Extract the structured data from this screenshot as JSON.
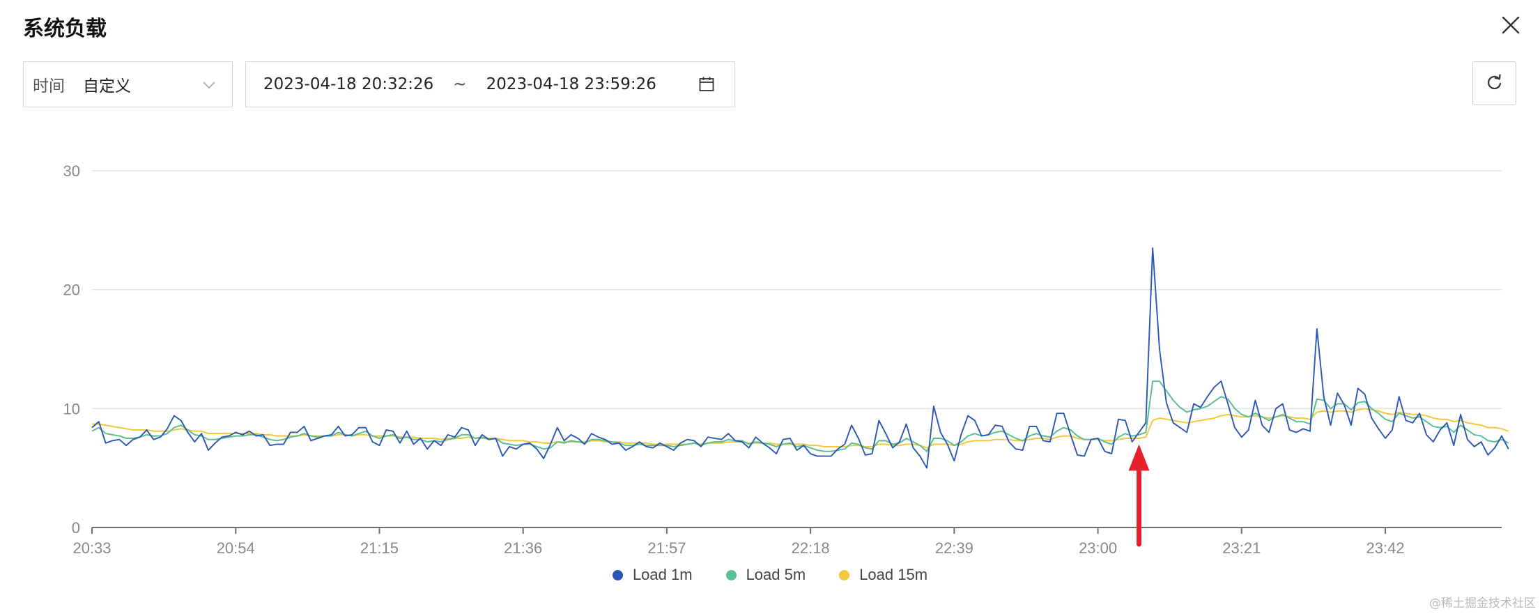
{
  "header": {
    "title": "系统负载"
  },
  "controls": {
    "time_label": "时间",
    "time_value": "自定义",
    "range_start": "2023-04-18 20:32:26",
    "range_separator": "~",
    "range_end": "2023-04-18 23:59:26"
  },
  "watermark": "@稀土掘金技术社区",
  "colors": {
    "load1": "#2a56b5",
    "load5": "#5cbf94",
    "load15": "#f2c83e",
    "grid": "#e2e2e2",
    "axis_text": "#888888",
    "arrow": "#e8202c"
  },
  "chart_data": {
    "type": "line",
    "title": "",
    "xlabel": "",
    "ylabel": "",
    "ylim": [
      0,
      30
    ],
    "yticks": [
      0,
      10,
      20,
      30
    ],
    "xticks": [
      "20:33",
      "20:54",
      "21:15",
      "21:36",
      "21:57",
      "22:18",
      "22:39",
      "23:00",
      "23:21",
      "23:42"
    ],
    "x_range": [
      "20:33",
      "23:59"
    ],
    "x_interval_minutes": 1,
    "grid": true,
    "legend_position": "bottom",
    "annotation": {
      "type": "arrow",
      "points_to": "23:06",
      "value": 7
    },
    "series": [
      {
        "name": "Load 1m",
        "values": [
          8.4,
          8.9,
          7.1,
          7.3,
          7.4,
          6.9,
          7.4,
          7.6,
          8.2,
          7.4,
          7.6,
          8.3,
          9.4,
          9.0,
          8.0,
          7.2,
          7.9,
          6.5,
          7.1,
          7.6,
          7.7,
          8.0,
          7.8,
          8.1,
          7.7,
          7.8,
          6.9,
          7.0,
          7.0,
          8.0,
          8.0,
          8.5,
          7.3,
          7.5,
          7.7,
          7.8,
          8.5,
          7.7,
          7.8,
          8.4,
          8.4,
          7.2,
          6.9,
          8.2,
          8.1,
          7.1,
          8.1,
          7.0,
          7.5,
          6.6,
          7.3,
          6.9,
          7.8,
          7.6,
          8.4,
          8.2,
          6.9,
          7.8,
          7.4,
          7.5,
          6.0,
          6.8,
          6.6,
          7.0,
          7.1,
          6.6,
          5.8,
          7.0,
          8.4,
          7.3,
          7.8,
          7.5,
          7.0,
          7.9,
          7.6,
          7.4,
          7.0,
          7.1,
          6.5,
          6.8,
          7.2,
          6.8,
          6.7,
          7.1,
          6.8,
          6.5,
          7.1,
          7.4,
          7.3,
          6.8,
          7.6,
          7.5,
          7.4,
          7.9,
          7.3,
          7.2,
          6.7,
          7.6,
          7.1,
          6.7,
          6.2,
          7.4,
          7.5,
          6.5,
          6.9,
          6.2,
          6.0,
          6.0,
          6.0,
          6.6,
          7.0,
          8.6,
          7.5,
          6.1,
          6.2,
          9.0,
          7.9,
          6.7,
          7.2,
          8.7,
          6.7,
          6.0,
          5.0,
          10.2,
          8.0,
          7.0,
          5.6,
          7.8,
          9.4,
          9.0,
          7.7,
          7.8,
          8.6,
          8.5,
          7.2,
          6.6,
          6.5,
          8.5,
          8.5,
          7.3,
          7.2,
          9.6,
          9.6,
          7.8,
          6.1,
          6.0,
          7.4,
          7.5,
          6.4,
          6.2,
          9.1,
          9.0,
          7.2,
          8.0,
          8.8,
          23.5,
          15.0,
          10.5,
          8.8,
          8.4,
          8.0,
          10.4,
          10.1,
          11.0,
          11.8,
          12.3,
          10.4,
          8.4,
          7.6,
          8.2,
          10.7,
          8.6,
          8.0,
          10.0,
          10.4,
          8.2,
          8.0,
          8.3,
          8.1,
          16.7,
          11.0,
          8.6,
          11.3,
          10.3,
          8.6,
          11.7,
          11.2,
          9.2,
          8.3,
          7.5,
          8.2,
          11.0,
          9.0,
          8.8,
          9.6,
          7.8,
          7.2,
          8.2,
          8.8,
          6.9,
          9.5,
          7.4,
          6.8,
          7.2,
          6.1,
          6.7,
          7.7,
          6.6
        ]
      },
      {
        "name": "Load 5m",
        "values": [
          8.1,
          8.4,
          7.9,
          7.8,
          7.7,
          7.5,
          7.5,
          7.6,
          7.8,
          7.7,
          7.7,
          7.9,
          8.4,
          8.6,
          8.2,
          7.8,
          7.7,
          7.4,
          7.4,
          7.5,
          7.6,
          7.7,
          7.7,
          7.8,
          7.8,
          7.6,
          7.4,
          7.3,
          7.4,
          7.6,
          7.7,
          7.9,
          7.7,
          7.6,
          7.7,
          7.7,
          8.0,
          7.8,
          7.7,
          7.9,
          8.1,
          7.7,
          7.5,
          7.7,
          7.8,
          7.5,
          7.6,
          7.4,
          7.4,
          7.2,
          7.3,
          7.2,
          7.4,
          7.5,
          7.8,
          7.8,
          7.5,
          7.6,
          7.4,
          7.5,
          7.1,
          7.0,
          6.9,
          7.0,
          7.0,
          6.8,
          6.6,
          6.7,
          7.2,
          7.1,
          7.3,
          7.2,
          7.1,
          7.4,
          7.4,
          7.3,
          7.2,
          7.1,
          6.9,
          6.9,
          7.0,
          6.9,
          6.9,
          6.9,
          6.9,
          6.8,
          6.9,
          7.0,
          7.1,
          6.9,
          7.1,
          7.2,
          7.2,
          7.4,
          7.3,
          7.3,
          7.0,
          7.2,
          7.1,
          7.0,
          6.8,
          7.0,
          7.1,
          6.8,
          6.9,
          6.7,
          6.5,
          6.4,
          6.4,
          6.5,
          6.6,
          7.1,
          7.0,
          6.7,
          6.6,
          7.3,
          7.3,
          7.0,
          7.1,
          7.5,
          7.2,
          6.9,
          6.4,
          7.5,
          7.5,
          7.3,
          6.9,
          7.2,
          7.7,
          7.9,
          7.7,
          7.8,
          8.0,
          8.1,
          7.8,
          7.5,
          7.3,
          7.7,
          7.9,
          7.7,
          7.6,
          8.1,
          8.4,
          8.2,
          7.7,
          7.4,
          7.4,
          7.5,
          7.2,
          7.0,
          7.6,
          7.9,
          7.7,
          7.8,
          8.0,
          12.3,
          12.3,
          11.5,
          10.7,
          10.1,
          9.7,
          9.9,
          10.0,
          10.2,
          10.6,
          11.0,
          10.8,
          10.0,
          9.5,
          9.3,
          9.6,
          9.3,
          9.0,
          9.3,
          9.5,
          9.2,
          8.9,
          8.9,
          8.7,
          10.8,
          10.7,
          10.0,
          10.4,
          10.4,
          9.9,
          10.5,
          10.6,
          10.0,
          9.6,
          9.1,
          8.9,
          9.6,
          9.4,
          9.2,
          9.3,
          8.9,
          8.5,
          8.4,
          8.5,
          8.0,
          8.6,
          8.2,
          7.8,
          7.7,
          7.3,
          7.2,
          7.4,
          7.1
        ]
      },
      {
        "name": "Load 15m",
        "values": [
          8.7,
          8.7,
          8.6,
          8.5,
          8.4,
          8.3,
          8.2,
          8.2,
          8.2,
          8.1,
          8.1,
          8.1,
          8.2,
          8.3,
          8.2,
          8.1,
          8.1,
          7.9,
          7.9,
          7.9,
          7.9,
          7.9,
          7.9,
          7.9,
          7.9,
          7.8,
          7.8,
          7.7,
          7.7,
          7.7,
          7.7,
          7.8,
          7.7,
          7.7,
          7.7,
          7.7,
          7.8,
          7.8,
          7.7,
          7.8,
          7.8,
          7.7,
          7.7,
          7.7,
          7.7,
          7.6,
          7.6,
          7.6,
          7.5,
          7.5,
          7.5,
          7.4,
          7.5,
          7.5,
          7.5,
          7.6,
          7.5,
          7.5,
          7.5,
          7.5,
          7.4,
          7.3,
          7.3,
          7.3,
          7.2,
          7.2,
          7.1,
          7.1,
          7.2,
          7.2,
          7.2,
          7.2,
          7.2,
          7.3,
          7.3,
          7.2,
          7.2,
          7.2,
          7.1,
          7.1,
          7.1,
          7.1,
          7.0,
          7.0,
          7.0,
          7.0,
          7.0,
          7.0,
          7.1,
          7.0,
          7.1,
          7.1,
          7.1,
          7.2,
          7.2,
          7.2,
          7.1,
          7.1,
          7.1,
          7.1,
          7.0,
          7.0,
          7.0,
          7.0,
          7.0,
          6.9,
          6.9,
          6.8,
          6.8,
          6.8,
          6.8,
          6.9,
          6.9,
          6.8,
          6.8,
          7.0,
          7.0,
          6.9,
          6.9,
          7.0,
          7.0,
          6.9,
          6.7,
          7.0,
          7.0,
          7.0,
          6.9,
          7.0,
          7.2,
          7.3,
          7.3,
          7.3,
          7.4,
          7.4,
          7.4,
          7.3,
          7.3,
          7.4,
          7.5,
          7.5,
          7.4,
          7.6,
          7.7,
          7.7,
          7.5,
          7.4,
          7.4,
          7.4,
          7.3,
          7.3,
          7.4,
          7.5,
          7.5,
          7.5,
          7.6,
          9.0,
          9.2,
          9.1,
          9.0,
          8.9,
          8.8,
          8.9,
          9.0,
          9.1,
          9.2,
          9.4,
          9.5,
          9.4,
          9.3,
          9.3,
          9.4,
          9.3,
          9.2,
          9.3,
          9.4,
          9.3,
          9.2,
          9.2,
          9.1,
          9.7,
          9.8,
          9.7,
          9.8,
          9.8,
          9.7,
          9.9,
          10.0,
          9.9,
          9.8,
          9.6,
          9.5,
          9.7,
          9.6,
          9.5,
          9.5,
          9.4,
          9.2,
          9.1,
          9.1,
          8.9,
          9.0,
          8.8,
          8.7,
          8.6,
          8.4,
          8.4,
          8.3,
          8.1
        ]
      }
    ]
  }
}
